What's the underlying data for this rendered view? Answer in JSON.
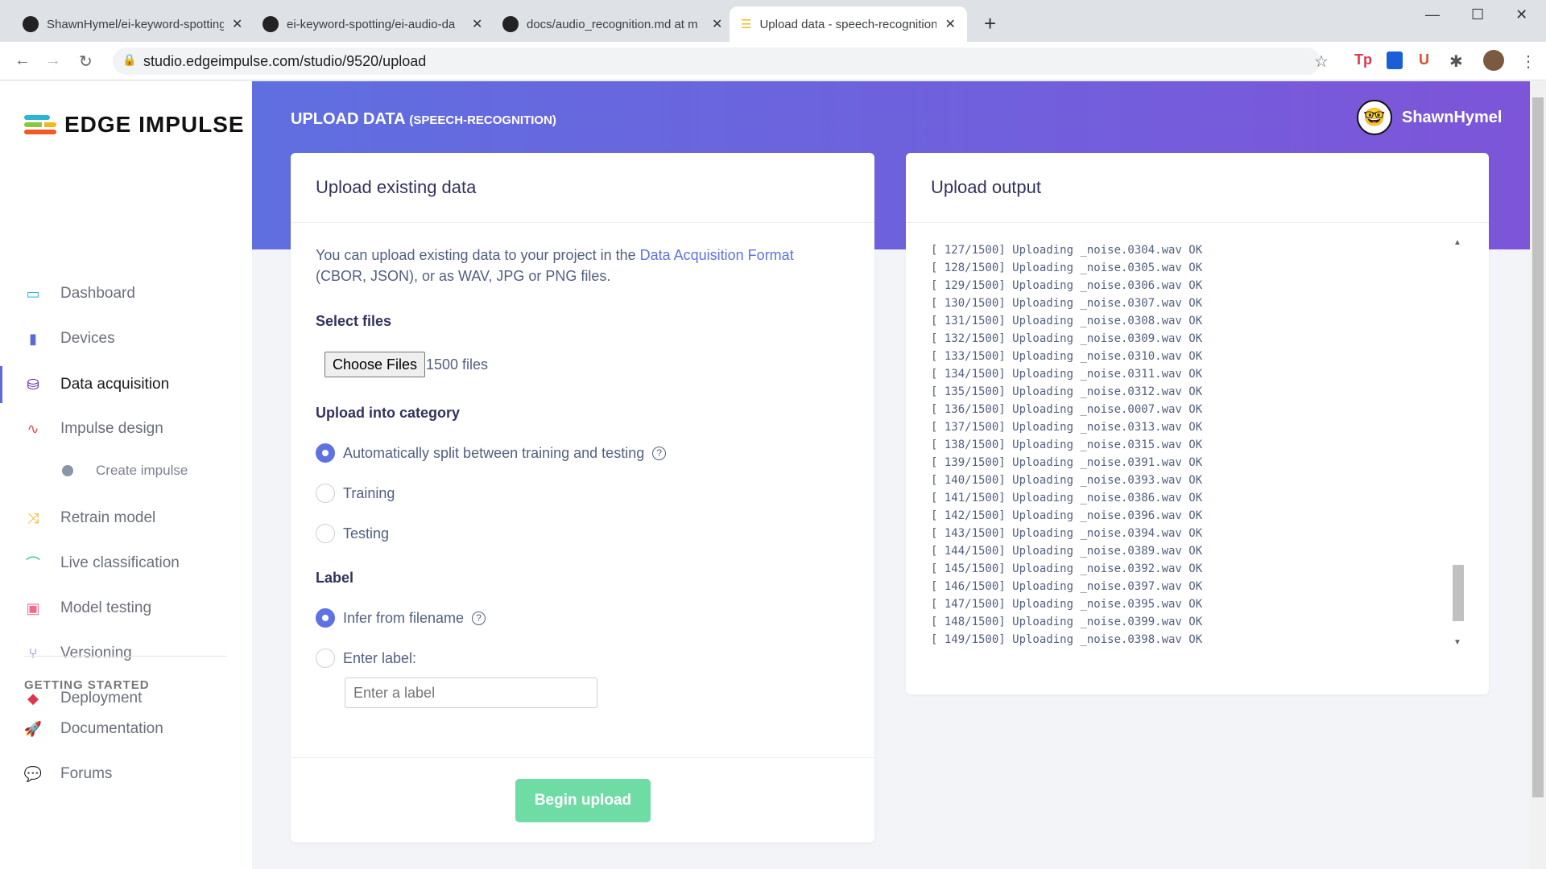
{
  "browser": {
    "tabs": [
      {
        "title": "ShawnHymel/ei-keyword-spotting"
      },
      {
        "title": "ei-keyword-spotting/ei-audio-da"
      },
      {
        "title": "docs/audio_recognition.md at m"
      },
      {
        "title": "Upload data - speech-recognition"
      }
    ],
    "url": "studio.edgeimpulse.com/studio/9520/upload",
    "new_tab": "+"
  },
  "brand": {
    "name": "EDGE IMPULSE"
  },
  "sidebar": {
    "items": [
      {
        "label": "Dashboard",
        "icon": "monitor-icon",
        "color": "#2bb5d6"
      },
      {
        "label": "Devices",
        "icon": "chip-icon",
        "color": "#5b6ad8"
      },
      {
        "label": "Data acquisition",
        "icon": "database-icon",
        "color": "#4b0fa8"
      },
      {
        "label": "Impulse design",
        "icon": "pulse-icon",
        "color": "#e84b4b"
      },
      {
        "label": "Retrain model",
        "icon": "shuffle-icon",
        "color": "#f2b71a"
      },
      {
        "label": "Live classification",
        "icon": "live-icon",
        "color": "#2dbd8a"
      },
      {
        "label": "Model testing",
        "icon": "clipboard-icon",
        "color": "#f06a8a"
      },
      {
        "label": "Versioning",
        "icon": "branch-icon",
        "color": "#5b6ad8"
      },
      {
        "label": "Deployment",
        "icon": "box-icon",
        "color": "#e0364b"
      }
    ],
    "sub_item": "Create impulse",
    "section": "GETTING STARTED",
    "extra": [
      {
        "label": "Documentation",
        "icon": "rocket-icon"
      },
      {
        "label": "Forums",
        "icon": "chat-icon"
      }
    ]
  },
  "header": {
    "title": "UPLOAD DATA",
    "project": "(SPEECH-RECOGNITION)",
    "user": "ShawnHymel"
  },
  "upload": {
    "title": "Upload existing data",
    "intro_pre": "You can upload existing data to your project in the ",
    "intro_link": "Data Acquisition Format",
    "intro_post": "(CBOR, JSON), or as WAV, JPG or PNG files.",
    "select_files": "Select files",
    "choose_files": "Choose Files",
    "files_count": "1500 files",
    "category_label": "Upload into category",
    "categories": [
      {
        "label": "Automatically split between training and testing",
        "selected": true
      },
      {
        "label": "Training",
        "selected": false
      },
      {
        "label": "Testing",
        "selected": false
      }
    ],
    "label_label": "Label",
    "label_options": [
      {
        "label": "Infer from filename",
        "selected": true
      },
      {
        "label": "Enter label:",
        "selected": false
      }
    ],
    "label_placeholder": "Enter a label",
    "begin": "Begin upload"
  },
  "output": {
    "title": "Upload output",
    "lines": [
      "[ 127/1500] Uploading _noise.0304.wav OK",
      "[ 128/1500] Uploading _noise.0305.wav OK",
      "[ 129/1500] Uploading _noise.0306.wav OK",
      "[ 130/1500] Uploading _noise.0307.wav OK",
      "[ 131/1500] Uploading _noise.0308.wav OK",
      "[ 132/1500] Uploading _noise.0309.wav OK",
      "[ 133/1500] Uploading _noise.0310.wav OK",
      "[ 134/1500] Uploading _noise.0311.wav OK",
      "[ 135/1500] Uploading _noise.0312.wav OK",
      "[ 136/1500] Uploading _noise.0007.wav OK",
      "[ 137/1500] Uploading _noise.0313.wav OK",
      "[ 138/1500] Uploading _noise.0315.wav OK",
      "[ 139/1500] Uploading _noise.0391.wav OK",
      "[ 140/1500] Uploading _noise.0393.wav OK",
      "[ 141/1500] Uploading _noise.0386.wav OK",
      "[ 142/1500] Uploading _noise.0396.wav OK",
      "[ 143/1500] Uploading _noise.0394.wav OK",
      "[ 144/1500] Uploading _noise.0389.wav OK",
      "[ 145/1500] Uploading _noise.0392.wav OK",
      "[ 146/1500] Uploading _noise.0397.wav OK",
      "[ 147/1500] Uploading _noise.0395.wav OK",
      "[ 148/1500] Uploading _noise.0399.wav OK",
      "[ 149/1500] Uploading _noise.0398.wav OK"
    ]
  }
}
